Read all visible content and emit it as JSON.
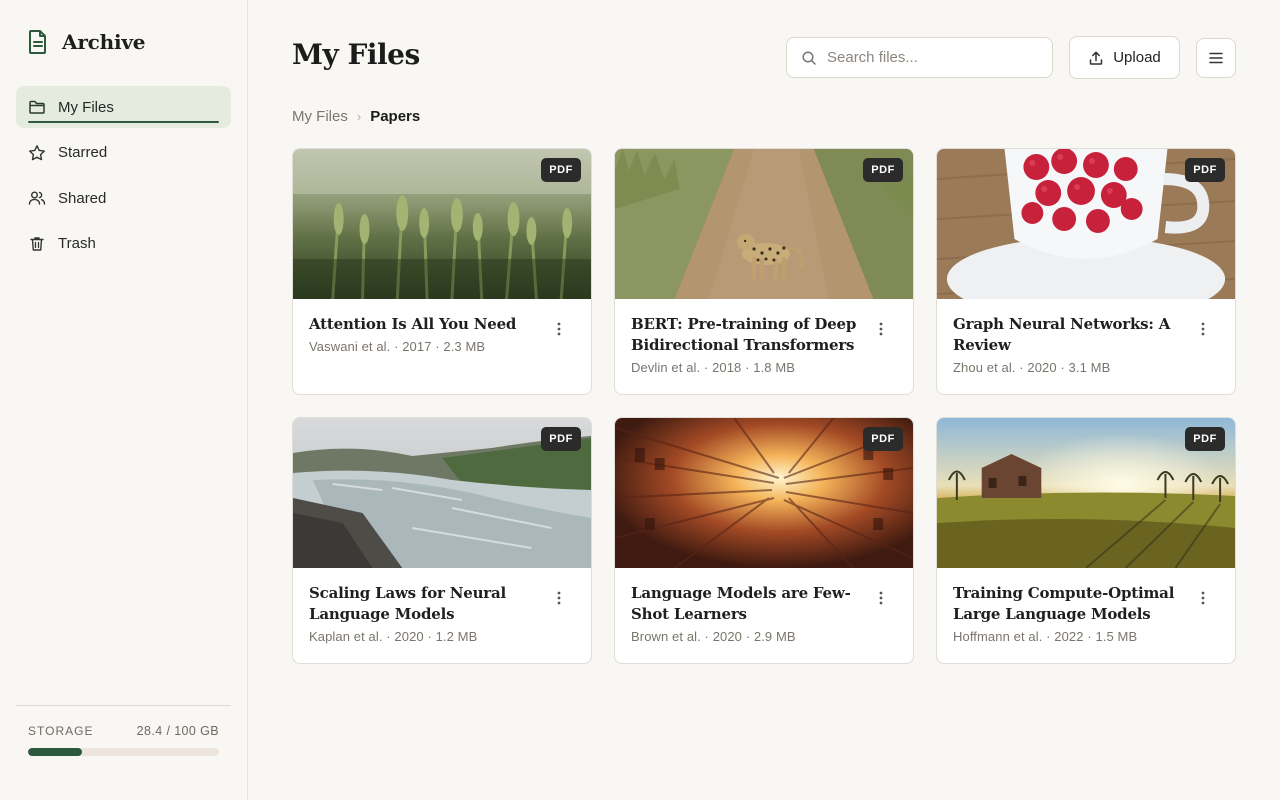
{
  "app": {
    "title": "Archive"
  },
  "sidebar": {
    "items": [
      {
        "label": "My Files",
        "icon": "folder-icon",
        "active": true
      },
      {
        "label": "Starred",
        "icon": "star-icon",
        "active": false
      },
      {
        "label": "Shared",
        "icon": "users-icon",
        "active": false
      },
      {
        "label": "Trash",
        "icon": "trash-icon",
        "active": false
      }
    ],
    "storage": {
      "label": "STORAGE",
      "amount": "28.4 / 100 GB",
      "used_fraction": 0.284
    }
  },
  "header": {
    "title": "My Files",
    "search_placeholder": "Search files...",
    "upload_label": "Upload"
  },
  "breadcrumb": {
    "root": "My Files",
    "separator": "›",
    "current": "Papers"
  },
  "files": [
    {
      "title": "Attention Is All You Need",
      "meta": "Vaswani et al. · 2017 · 2.3 MB",
      "badge": "PDF",
      "thumbnail": "wheat-field"
    },
    {
      "title": "BERT: Pre-training of Deep Bidirectional Transformers",
      "meta": "Devlin et al. · 2018 · 1.8 MB",
      "badge": "PDF",
      "thumbnail": "leopard-path"
    },
    {
      "title": "Graph Neural Networks: A Review",
      "meta": "Zhou et al. · 2020 · 3.1 MB",
      "badge": "PDF",
      "thumbnail": "raspberries-cup"
    },
    {
      "title": "Scaling Laws for Neural Language Models",
      "meta": "Kaplan et al. · 2020 · 1.2 MB",
      "badge": "PDF",
      "thumbnail": "waterfall"
    },
    {
      "title": "Language Models are Few-Shot Learners",
      "meta": "Brown et al. · 2020 · 2.9 MB",
      "badge": "PDF",
      "thumbnail": "building-courtyard"
    },
    {
      "title": "Training Compute-Optimal Large Language Models",
      "meta": "Hoffmann et al. · 2022 · 1.5 MB",
      "badge": "PDF",
      "thumbnail": "sunset-farmhouse"
    }
  ],
  "colors": {
    "accent": "#2d5a3d",
    "active_bg": "#e5ecdf",
    "background": "#f8f7f4"
  }
}
